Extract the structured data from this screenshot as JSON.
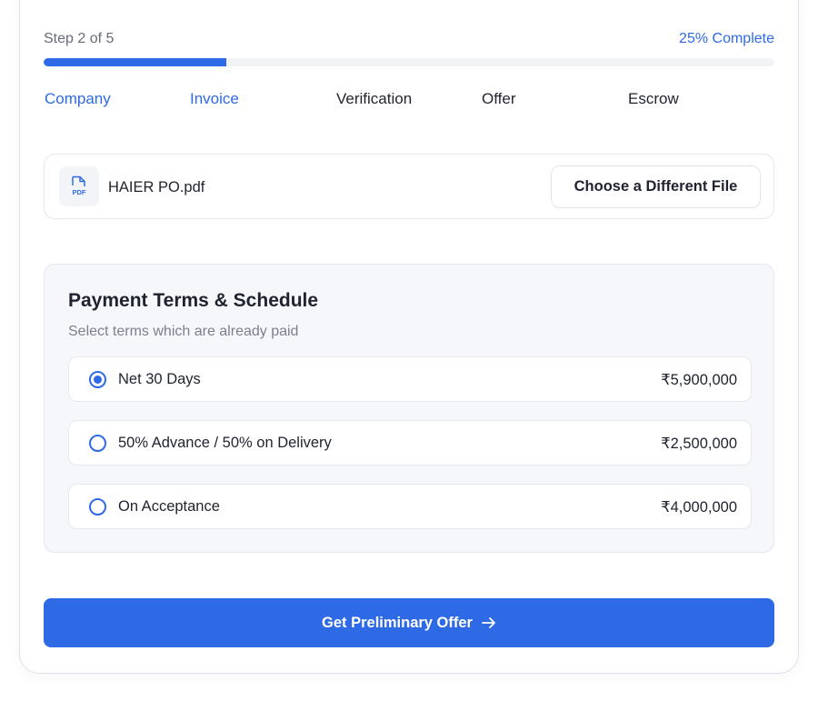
{
  "progress": {
    "step_text": "Step 2 of 5",
    "percent_text": "25% Complete",
    "percent_value": 25,
    "fill_color": "#2f6ae6"
  },
  "stepper": {
    "steps": [
      {
        "label": "Company",
        "state": "completed"
      },
      {
        "label": "Invoice",
        "state": "current"
      },
      {
        "label": "Verification",
        "state": "upcoming"
      },
      {
        "label": "Offer",
        "state": "upcoming"
      },
      {
        "label": "Escrow",
        "state": "upcoming"
      }
    ]
  },
  "file": {
    "icon": "pdf-file-icon",
    "icon_text": "PDF",
    "name": "HAIER PO.pdf",
    "change_button_label": "Choose a Different File"
  },
  "payment_terms": {
    "title": "Payment Terms & Schedule",
    "subtitle": "Select terms which are already paid",
    "options": [
      {
        "label": "Net 30 Days",
        "amount": "₹5,900,000",
        "selected": true
      },
      {
        "label": "50% Advance / 50% on Delivery",
        "amount": "₹2,500,000",
        "selected": false
      },
      {
        "label": "On Acceptance",
        "amount": "₹4,000,000",
        "selected": false
      }
    ]
  },
  "cta": {
    "label": "Get Preliminary Offer",
    "icon": "arrow-right-icon",
    "color": "#2f6ae6"
  },
  "colors": {
    "accent": "#2f6ae6",
    "text": "#1f2330",
    "muted": "#666c78",
    "panel_bg": "#f6f7fa"
  }
}
